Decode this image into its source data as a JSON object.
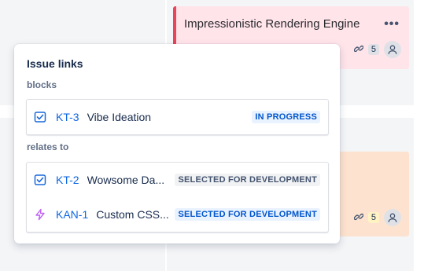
{
  "board": {
    "card_pink": {
      "title": "Impressionistic Rendering Engine",
      "more_label": "•••",
      "link_count": "5"
    },
    "card_orange": {
      "link_count": "5"
    }
  },
  "popup": {
    "title": "Issue links",
    "sections": [
      {
        "label": "blocks",
        "items": [
          {
            "key": "KT-3",
            "summary": "Vibe Ideation",
            "status": "IN PROGRESS",
            "status_color": "#0055cc",
            "icon": "task-checkbox-icon"
          }
        ]
      },
      {
        "label": "relates to",
        "items": [
          {
            "key": "KT-2",
            "summary": "Wowsome Da...",
            "status": "SELECTED FOR DEVELOPMENT",
            "status_color": "#44546f",
            "icon": "task-checkbox-icon"
          },
          {
            "key": "KAN-1",
            "summary": "Custom CSS...",
            "status": "SELECTED FOR DEVELOPMENT",
            "status_color": "#0055cc",
            "icon": "lightning-icon"
          }
        ]
      }
    ]
  },
  "colors": {
    "link_blue": "#0c66e4",
    "pink_card": "#ffe4ea",
    "pink_border": "#e8445a",
    "orange_card": "#fde3cf",
    "task_icon": "#1868db",
    "lightning_icon": "#bf63f3"
  }
}
